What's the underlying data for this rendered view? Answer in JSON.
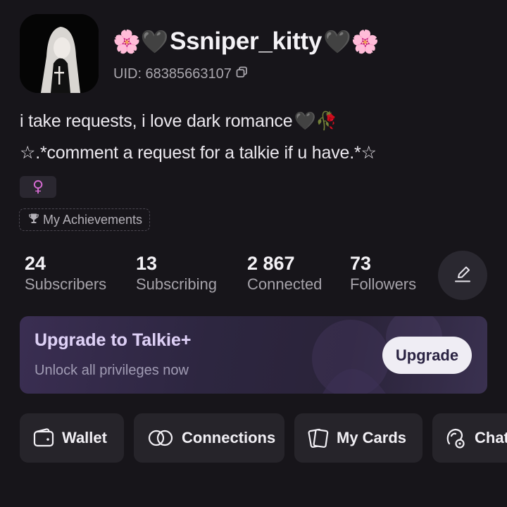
{
  "profile": {
    "name": "Ssniper_kitty",
    "name_decor_left": "🌸🖤",
    "name_decor_right": "🖤🌸",
    "uid_label": "UID: 68385663107",
    "bio_line1": "i take requests, i love dark romance",
    "bio_line1_emoji": "🖤🥀",
    "bio_line2": "☆.*comment a request for a talkie if u have.*☆",
    "gender_symbol": "♀",
    "achievements_label": "My Achievements"
  },
  "stats": [
    {
      "value": "24",
      "label": "Subscribers"
    },
    {
      "value": "13",
      "label": "Subscribing"
    },
    {
      "value": "2 867",
      "label": "Connected"
    },
    {
      "value": "73",
      "label": "Followers"
    }
  ],
  "upgrade": {
    "title": "Upgrade to Talkie+",
    "subtitle": "Unlock all privileges now",
    "button": "Upgrade"
  },
  "actions": [
    {
      "label": "Wallet",
      "icon": "wallet-icon"
    },
    {
      "label": "Connections",
      "icon": "connections-icon"
    },
    {
      "label": "My Cards",
      "icon": "cards-icon"
    },
    {
      "label": "Chat",
      "icon": "chat-icon"
    }
  ],
  "icons": {
    "copy": "copy-icon",
    "trophy": "trophy-icon",
    "edit": "edit-icon"
  },
  "colors": {
    "background": "#17151a",
    "gender": "#d66bd2",
    "banner_title": "#ddd0f5"
  }
}
